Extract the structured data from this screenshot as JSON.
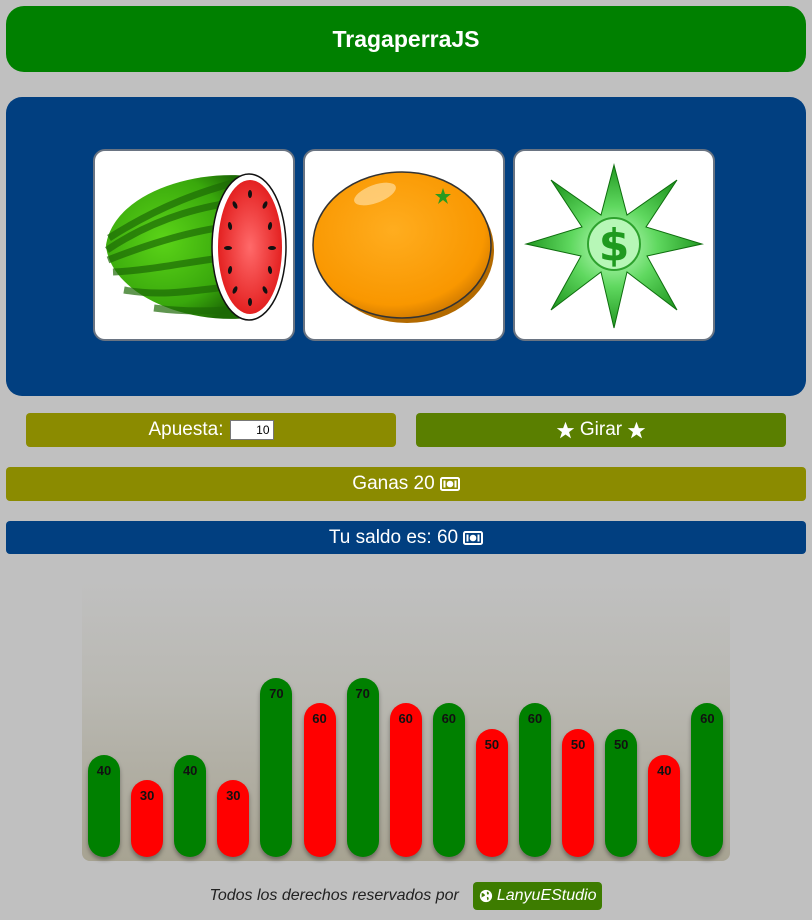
{
  "header": {
    "title": "TragaperraJS"
  },
  "reels": [
    {
      "symbol": "watermelon-icon"
    },
    {
      "symbol": "orange-icon"
    },
    {
      "symbol": "dollar-star-icon"
    }
  ],
  "controls": {
    "bet_label": "Apuesta:",
    "bet_value": "10",
    "spin_label": "Girar"
  },
  "status": {
    "win_text": "Ganas 20",
    "balance_text": "Tu saldo es: 60"
  },
  "colors": {
    "win": "#008000",
    "loss": "#ff0000"
  },
  "chart_data": {
    "type": "bar",
    "ylim": [
      0,
      100
    ],
    "values": [
      40,
      30,
      40,
      30,
      70,
      60,
      70,
      60,
      60,
      50,
      60,
      50,
      50,
      40,
      60
    ],
    "labels": [
      "40",
      "30",
      "40",
      "30",
      "70",
      "60",
      "70",
      "60",
      "60",
      "50",
      "60",
      "50",
      "50",
      "40",
      "60"
    ],
    "colors": [
      "green",
      "red",
      "green",
      "red",
      "green",
      "red",
      "green",
      "red",
      "green",
      "red",
      "green",
      "red",
      "green",
      "red",
      "green"
    ]
  },
  "footer": {
    "text": "Todos los derechos reservados por",
    "studio": "LanyuEStudio"
  }
}
